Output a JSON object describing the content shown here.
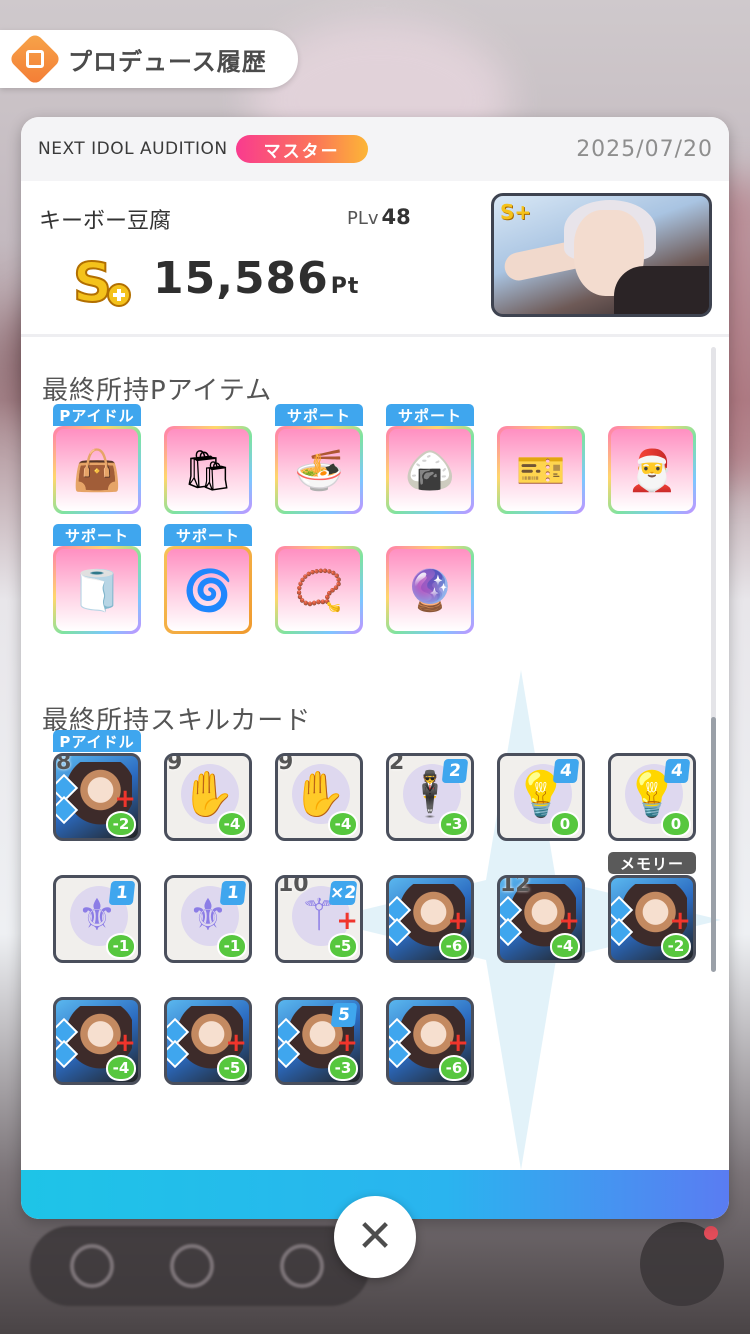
{
  "header": {
    "title": "プロデュース履歴"
  },
  "event": {
    "name": "NEXT IDOL AUDITION",
    "difficulty": "マスター",
    "date": "2025/07/20"
  },
  "result": {
    "player_name": "キーボー豆腐",
    "plv_label": "PLv",
    "plv_value": "48",
    "rank": "S+",
    "score": "15,586",
    "score_unit": "Pt"
  },
  "items_section": {
    "title": "最終所持Pアイテム",
    "items": [
      {
        "tag": "Pアイドル",
        "icon": "tote-bag",
        "emoji": "👜"
      },
      {
        "tag": "",
        "icon": "snack-bag",
        "emoji": "🛍"
      },
      {
        "tag": "サポート",
        "icon": "ramen-pack",
        "emoji": "🍜"
      },
      {
        "tag": "サポート",
        "icon": "onigiri-pack",
        "emoji": "🍙"
      },
      {
        "tag": "",
        "icon": "nia-card",
        "emoji": "🎫"
      },
      {
        "tag": "",
        "icon": "santa-charm",
        "emoji": "🎅"
      },
      {
        "tag": "サポート",
        "icon": "handkerchief",
        "emoji": "🧻"
      },
      {
        "tag": "サポート",
        "icon": "desk-fan",
        "emoji": "🌀"
      },
      {
        "tag": "",
        "icon": "gold-bracelet",
        "emoji": "📿"
      },
      {
        "tag": "",
        "icon": "crystal-orb",
        "emoji": "🔮"
      }
    ]
  },
  "cards_section": {
    "title": "最終所持スキルカード",
    "cards": [
      {
        "tag": "Pアイドル",
        "num": "8",
        "level": "",
        "cost": "-2",
        "plus": true,
        "photo": true,
        "glyph": ""
      },
      {
        "tag": "",
        "num": "9",
        "level": "",
        "cost": "-4",
        "plus": false,
        "photo": false,
        "glyph": "✋"
      },
      {
        "tag": "",
        "num": "9",
        "level": "",
        "cost": "-4",
        "plus": false,
        "photo": false,
        "glyph": "✋"
      },
      {
        "tag": "",
        "num": "2",
        "level": "2",
        "cost": "-3",
        "plus": false,
        "photo": false,
        "glyph": "🕴"
      },
      {
        "tag": "",
        "num": "",
        "level": "4",
        "cost": "0",
        "plus": false,
        "photo": false,
        "glyph": "💡"
      },
      {
        "tag": "",
        "num": "",
        "level": "4",
        "cost": "0",
        "plus": false,
        "photo": false,
        "glyph": "💡"
      },
      {
        "tag": "",
        "num": "",
        "level": "1",
        "cost": "-1",
        "plus": false,
        "photo": false,
        "glyph": "⚜"
      },
      {
        "tag": "",
        "num": "",
        "level": "1",
        "cost": "-1",
        "plus": false,
        "photo": false,
        "glyph": "⚜"
      },
      {
        "tag": "",
        "num": "10",
        "level": "×2",
        "cost": "-5",
        "plus": true,
        "photo": false,
        "glyph": "⚚"
      },
      {
        "tag": "",
        "num": "",
        "level": "",
        "cost": "-6",
        "plus": true,
        "photo": true,
        "glyph": ""
      },
      {
        "tag": "",
        "num": "12",
        "level": "",
        "cost": "-4",
        "plus": true,
        "photo": true,
        "glyph": ""
      },
      {
        "tag": "メモリー",
        "num": "",
        "level": "",
        "cost": "-2",
        "plus": true,
        "photo": true,
        "glyph": ""
      },
      {
        "tag": "",
        "num": "",
        "level": "",
        "cost": "-4",
        "plus": true,
        "photo": true,
        "glyph": ""
      },
      {
        "tag": "",
        "num": "",
        "level": "",
        "cost": "-5",
        "plus": true,
        "photo": true,
        "glyph": ""
      },
      {
        "tag": "",
        "num": "",
        "level": "5",
        "cost": "-3",
        "plus": true,
        "photo": true,
        "glyph": ""
      },
      {
        "tag": "",
        "num": "",
        "level": "",
        "cost": "-6",
        "plus": true,
        "photo": true,
        "glyph": ""
      }
    ]
  },
  "close_button": {
    "label": "✕"
  },
  "colors": {
    "accent": "#3fa6ee",
    "master_start": "#f93b8f",
    "master_end": "#fcb636",
    "footer": "#1ec4e7"
  }
}
